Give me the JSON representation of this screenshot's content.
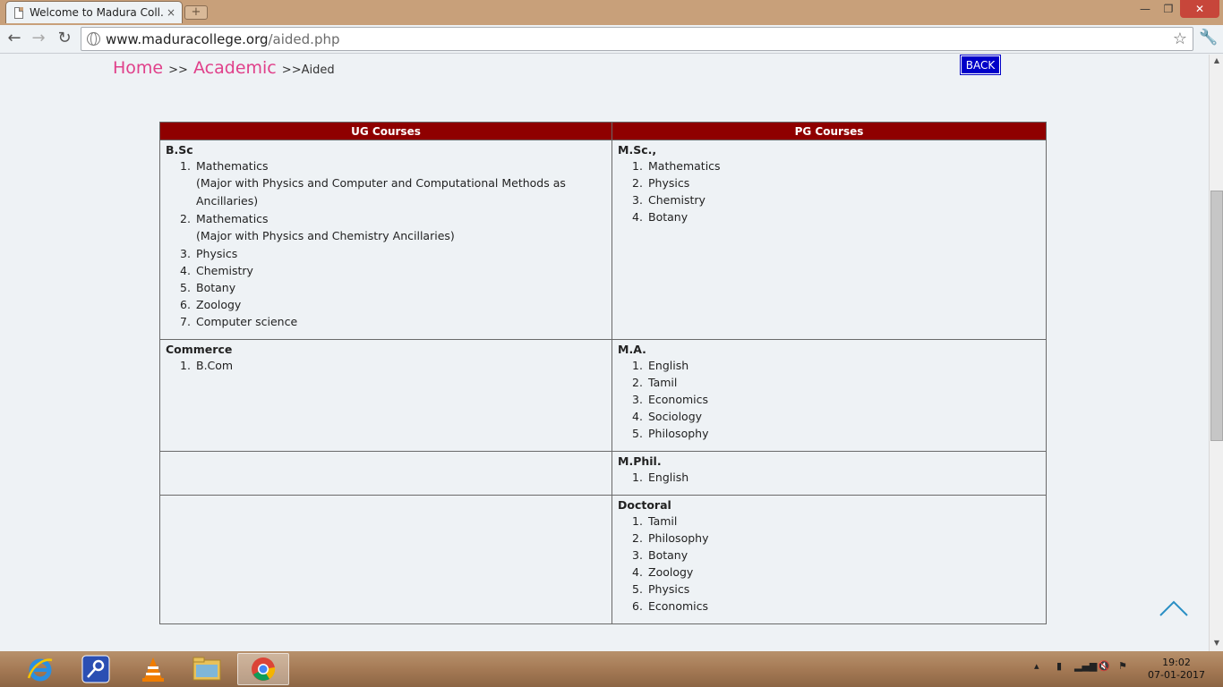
{
  "browser": {
    "tab_title": "Welcome to Madura Coll...",
    "tab_close": "×",
    "new_tab": "+",
    "url_domain": "www.maduracollege.org",
    "url_path": "/aided.php",
    "window_min": "—",
    "window_max": "❐",
    "window_close": "✕"
  },
  "breadcrumb": {
    "home": "Home",
    "sep1": ">>",
    "academic": "Academic",
    "sep2": ">>",
    "current": "Aided"
  },
  "back_button": "BACK",
  "table": {
    "headers": [
      "UG Courses",
      "PG Courses"
    ],
    "rows": [
      {
        "ug": {
          "title": "B.Sc",
          "items": [
            {
              "num": "1.",
              "label": "Mathematics",
              "note": "(Major with Physics and Computer and Computational Methods as Ancillaries)"
            },
            {
              "num": "2.",
              "label": "Mathematics",
              "note": "(Major with Physics and Chemistry Ancillaries)"
            },
            {
              "num": "3.",
              "label": "Physics"
            },
            {
              "num": "4.",
              "label": "Chemistry"
            },
            {
              "num": "5.",
              "label": "Botany"
            },
            {
              "num": "6.",
              "label": "Zoology"
            },
            {
              "num": "7.",
              "label": "Computer science"
            }
          ]
        },
        "pg": {
          "title": "M.Sc.,",
          "items": [
            {
              "num": "1.",
              "label": "Mathematics"
            },
            {
              "num": "2.",
              "label": "Physics"
            },
            {
              "num": "3.",
              "label": "Chemistry"
            },
            {
              "num": "4.",
              "label": "Botany"
            }
          ]
        }
      },
      {
        "ug": {
          "title": "Commerce",
          "items": [
            {
              "num": "1.",
              "label": "B.Com"
            }
          ]
        },
        "pg": {
          "title": "M.A.",
          "items": [
            {
              "num": "1.",
              "label": "English"
            },
            {
              "num": "2.",
              "label": "Tamil"
            },
            {
              "num": "3.",
              "label": "Economics"
            },
            {
              "num": "4.",
              "label": "Sociology"
            },
            {
              "num": "5.",
              "label": "Philosophy"
            }
          ]
        }
      },
      {
        "pg": {
          "title": "M.Phil.",
          "items": [
            {
              "num": "1.",
              "label": "English"
            }
          ]
        }
      },
      {
        "pg": {
          "title": "Doctoral",
          "items": [
            {
              "num": "1.",
              "label": "Tamil"
            },
            {
              "num": "2.",
              "label": "Philosophy"
            },
            {
              "num": "3.",
              "label": "Botany"
            },
            {
              "num": "4.",
              "label": "Zoology"
            },
            {
              "num": "5.",
              "label": "Physics"
            },
            {
              "num": "6.",
              "label": "Economics"
            }
          ]
        }
      }
    ]
  },
  "taskbar": {
    "apps": [
      "internet-explorer-icon",
      "keepass-icon",
      "vlc-icon",
      "file-explorer-icon",
      "chrome-icon"
    ],
    "time": "19:02",
    "date": "07-01-2017"
  },
  "colors": {
    "header_bg": "#8f0000",
    "breadcrumb_link": "#e0408a",
    "back_button_bg": "#0000c8",
    "scroll_top_arrow": "#2a8fc4"
  }
}
